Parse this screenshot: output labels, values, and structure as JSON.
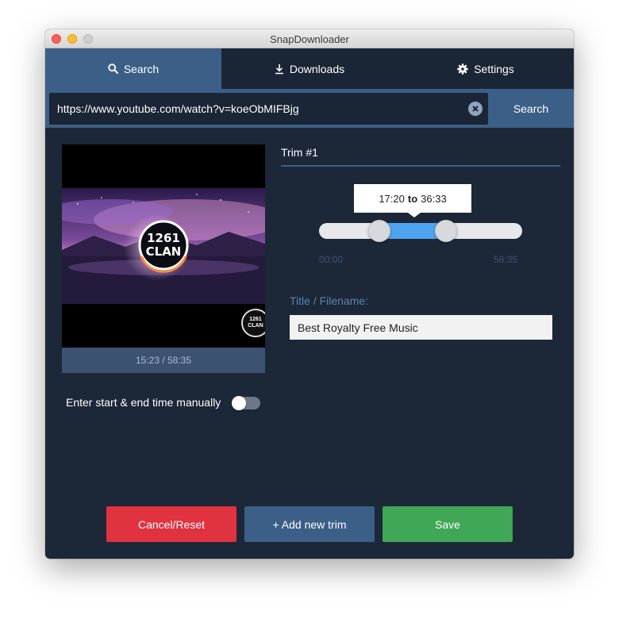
{
  "window": {
    "title": "SnapDownloader"
  },
  "tabs": [
    {
      "label": "Search",
      "icon": "search-icon",
      "active": true
    },
    {
      "label": "Downloads",
      "icon": "download-icon",
      "active": false
    },
    {
      "label": "Settings",
      "icon": "gear-icon",
      "active": false
    }
  ],
  "search": {
    "url_value": "https://www.youtube.com/watch?v=koeObMIFBjg",
    "clear_icon": "clear-icon",
    "button_label": "Search"
  },
  "preview": {
    "logo_text_line1": "1261",
    "logo_text_line2": "CLAN",
    "time_label": "15:23 / 58:35"
  },
  "manual": {
    "label": "Enter start & end time manually",
    "toggle_on": false
  },
  "trim": {
    "title": "Trim #1",
    "range_start": "17:20",
    "range_to": "to",
    "range_end": "36:33",
    "min_label": "00:00",
    "max_label": "58:35",
    "start_fraction": 0.296,
    "end_fraction": 0.624,
    "fill_color": "#4fa4f0"
  },
  "filename": {
    "label": "Title / Filename:",
    "value": "Best Royalty Free Music"
  },
  "actions": {
    "cancel_label": "Cancel/Reset",
    "add_label": "+ Add new trim",
    "save_label": "Save",
    "cancel_color": "#e0323f",
    "add_color": "#3b5f87",
    "save_color": "#3fa756"
  }
}
